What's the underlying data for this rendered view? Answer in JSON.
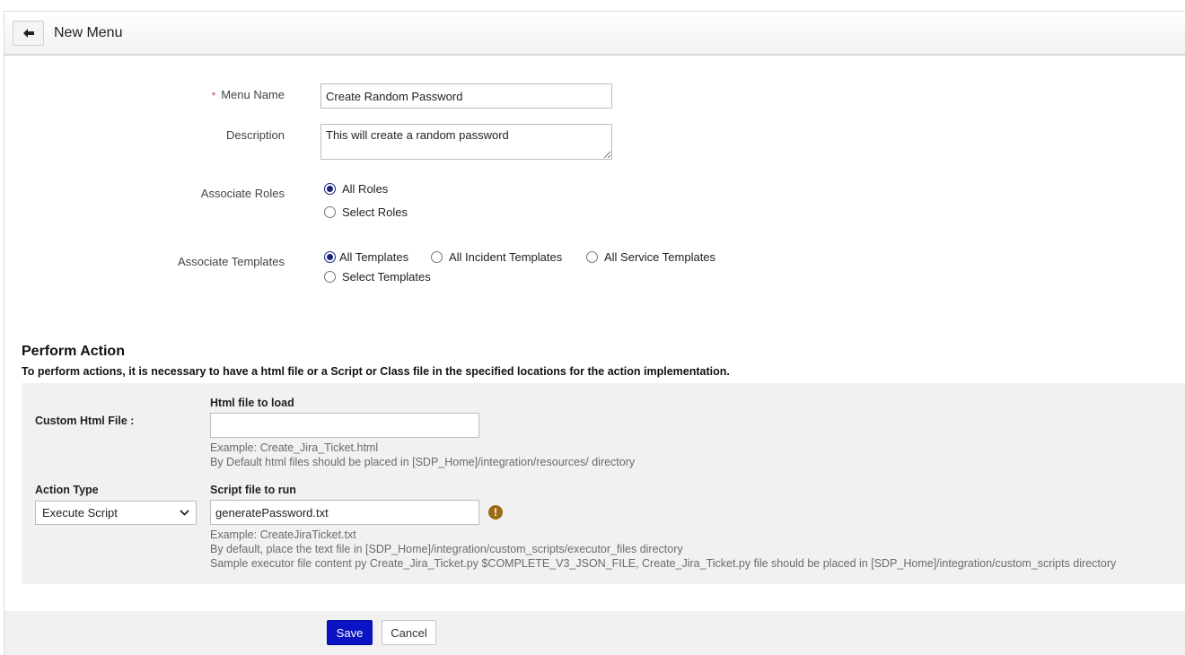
{
  "header": {
    "title": "New Menu",
    "back_icon": "arrow-left-icon"
  },
  "form": {
    "menu_name": {
      "label": "Menu Name",
      "required_mark": "*",
      "value": "Create Random Password"
    },
    "description": {
      "label": "Description",
      "value": "This will create a random password"
    },
    "roles": {
      "label": "Associate Roles",
      "options": [
        "All Roles",
        "Select Roles"
      ],
      "selected": "All Roles"
    },
    "templates": {
      "label": "Associate Templates",
      "options": [
        "All Templates",
        "All Incident Templates",
        "All Service Templates",
        "Select Templates"
      ],
      "selected": "All Templates"
    }
  },
  "perform_action": {
    "title": "Perform Action",
    "description": "To perform actions, it is necessary to have a html file or a Script or Class file in the specified locations for the action implementation.",
    "custom_html": {
      "label": "Custom Html File :",
      "field_label": "Html file to load",
      "value": "",
      "hint_1": "Example: Create_Jira_Ticket.html",
      "hint_2": "By Default html files should be placed in [SDP_Home]/integration/resources/ directory"
    },
    "action_type": {
      "label": "Action Type",
      "selected": "Execute Script",
      "field_label": "Script file to run",
      "value": "generatePassword.txt",
      "warning_icon": "exclamation-icon",
      "warning_glyph": "!",
      "hint_1": "Example: CreateJiraTicket.txt",
      "hint_2": "By default, place the text file in [SDP_Home]/integration/custom_scripts/executor_files directory",
      "hint_3": "Sample executor file content py Create_Jira_Ticket.py $COMPLETE_V3_JSON_FILE, Create_Jira_Ticket.py file should be placed in [SDP_Home]/integration/custom_scripts directory"
    }
  },
  "footer": {
    "save_label": "Save",
    "cancel_label": "Cancel"
  },
  "colors": {
    "primary_button": "#0a14c4",
    "radio_checked": "#1a237e",
    "warning": "#9c6a12",
    "required": "#d32f2f"
  }
}
